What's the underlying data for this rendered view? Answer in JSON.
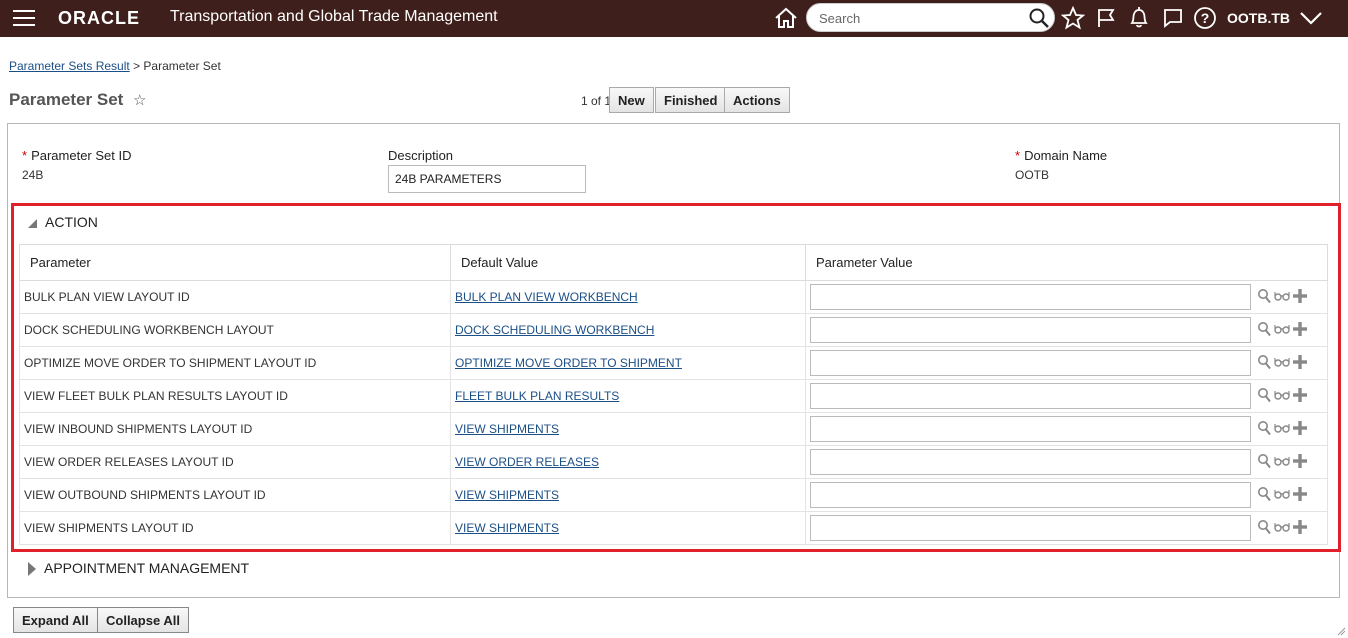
{
  "header": {
    "logo": "ORACLE",
    "app_title": "Transportation and Global Trade Management",
    "search_placeholder": "Search",
    "user": "OOTB.TB"
  },
  "breadcrumb": {
    "parent": "Parameter Sets Result",
    "separator": ">",
    "current": "Parameter Set"
  },
  "page": {
    "title": "Parameter Set",
    "pager": "1 of 1",
    "new_label": "New",
    "finished_label": "Finished",
    "actions_label": "Actions"
  },
  "form": {
    "param_set_id_label": "Parameter Set ID",
    "param_set_id_value": "24B",
    "description_label": "Description",
    "description_value": "24B PARAMETERS",
    "domain_label": "Domain Name",
    "domain_value": "OOTB",
    "required_marker": "*"
  },
  "sections": {
    "action": "ACTION",
    "appointment": "APPOINTMENT MANAGEMENT"
  },
  "table": {
    "columns": [
      "Parameter",
      "Default Value",
      "Parameter Value"
    ],
    "rows": [
      {
        "parameter": "BULK PLAN VIEW LAYOUT ID",
        "default": "BULK PLAN VIEW WORKBENCH",
        "value": ""
      },
      {
        "parameter": "DOCK SCHEDULING WORKBENCH LAYOUT",
        "default": "DOCK SCHEDULING WORKBENCH",
        "value": ""
      },
      {
        "parameter": "OPTIMIZE MOVE ORDER TO SHIPMENT LAYOUT ID",
        "default": "OPTIMIZE MOVE ORDER TO SHIPMENT",
        "value": ""
      },
      {
        "parameter": "VIEW FLEET BULK PLAN RESULTS LAYOUT ID",
        "default": "FLEET BULK PLAN RESULTS",
        "value": ""
      },
      {
        "parameter": "VIEW INBOUND SHIPMENTS LAYOUT ID",
        "default": "VIEW SHIPMENTS",
        "value": ""
      },
      {
        "parameter": "VIEW ORDER RELEASES LAYOUT ID",
        "default": "VIEW ORDER RELEASES",
        "value": ""
      },
      {
        "parameter": "VIEW OUTBOUND SHIPMENTS LAYOUT ID",
        "default": "VIEW SHIPMENTS",
        "value": ""
      },
      {
        "parameter": "VIEW SHIPMENTS LAYOUT ID",
        "default": "VIEW SHIPMENTS",
        "value": ""
      }
    ]
  },
  "footer": {
    "expand_all": "Expand All",
    "collapse_all": "Collapse All"
  },
  "colors": {
    "topbar": "#3e1f1b",
    "link": "#1b4f87",
    "highlight": "#e0202a",
    "required": "#cc0000"
  },
  "icons": [
    "hamburger-icon",
    "home-icon",
    "search-icon",
    "star-icon",
    "flag-icon",
    "bell-icon",
    "chat-icon",
    "help-icon",
    "chevron-down-icon",
    "magnifier-icon",
    "glasses-icon",
    "plus-icon"
  ]
}
